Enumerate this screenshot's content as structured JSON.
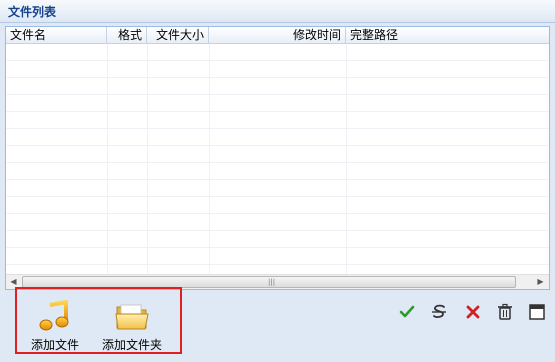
{
  "panel": {
    "title": "文件列表"
  },
  "table": {
    "columns": [
      {
        "label": "文件名"
      },
      {
        "label": "格式"
      },
      {
        "label": "文件大小"
      },
      {
        "label": "修改时间"
      },
      {
        "label": "完整路径"
      }
    ],
    "rows": []
  },
  "toolbar": {
    "add_file_label": "添加文件",
    "add_folder_label": "添加文件夹"
  },
  "actions": [
    {
      "icon": "checkmark-icon"
    },
    {
      "icon": "rename-icon"
    },
    {
      "icon": "close-icon"
    },
    {
      "icon": "trash-icon"
    },
    {
      "icon": "window-icon"
    }
  ],
  "colors": {
    "accent": "#15428b",
    "highlight_border": "#e02020",
    "check": "#2e9a2e",
    "delete": "#d02020"
  }
}
